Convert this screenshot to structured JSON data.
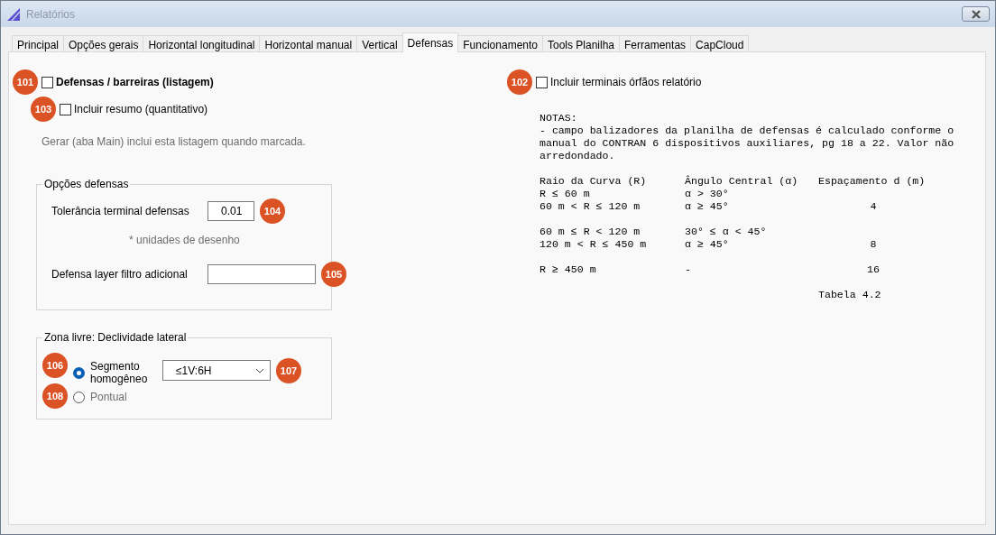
{
  "window": {
    "title": "Relatórios"
  },
  "tabs": [
    {
      "label": "Principal",
      "selected": false
    },
    {
      "label": "Opções gerais",
      "selected": false
    },
    {
      "label": "Horizontal longitudinal",
      "selected": false
    },
    {
      "label": "Horizontal manual",
      "selected": false
    },
    {
      "label": "Vertical",
      "selected": false
    },
    {
      "label": "Defensas",
      "selected": true
    },
    {
      "label": "Funcionamento",
      "selected": false
    },
    {
      "label": "Tools Planilha",
      "selected": false
    },
    {
      "label": "Ferramentas",
      "selected": false
    },
    {
      "label": "CapCloud",
      "selected": false
    }
  ],
  "listing_checkbox": {
    "label": "Defensas / barreiras (listagem)",
    "checked": false,
    "badge": "101"
  },
  "summary_checkbox": {
    "label": "Incluir resumo (quantitativo)",
    "checked": false,
    "badge": "103"
  },
  "hint": "Gerar (aba Main) inclui esta listagem quando marcada.",
  "options_group": {
    "title": "Opções defensas",
    "tolerance_field": {
      "label": "Tolerância terminal defensas",
      "value": "0.01",
      "badge": "104"
    },
    "units_note": "* unidades de desenho",
    "layer_field": {
      "label": "Defensa layer filtro adicional",
      "badge": "105"
    }
  },
  "slope_group": {
    "title": "Zona livre: Declividade lateral",
    "radios": [
      {
        "label": "Segmento homogêneo",
        "selected": true,
        "disabled": false,
        "badge": "106"
      },
      {
        "label": "Pontual",
        "selected": false,
        "disabled": true,
        "badge": "108"
      }
    ],
    "dropdown": {
      "value": "≤1V:6H",
      "badge": "107"
    }
  },
  "orphans_checkbox": {
    "label": "Incluir terminais órfãos relatório",
    "checked": false,
    "badge": "102"
  },
  "notes": {
    "title": "NOTAS:",
    "paragraph": "- campo balizadores da planilha de defensas é calculado conforme o manual do CONTRAN 6 dispositivos auxiliares, pg 18 a 22. Valor não arredondado.",
    "columns": [
      "Raio da Curva (R)",
      "Ângulo Central (α)",
      "Espaçamento d (m)"
    ],
    "groups": [
      [
        {
          "radius": "R ≤ 60 m",
          "angle": "α > 30°"
        },
        {
          "radius": "60 m < R ≤ 120 m",
          "angle": "α ≥ 45°",
          "spacing": "4"
        }
      ],
      [
        {
          "radius": "60 m ≤ R < 120 m",
          "angle": "30° ≤ α < 45°"
        },
        {
          "radius": "120 m < R ≤ 450 m",
          "angle": "α ≥ 45°",
          "spacing": "8"
        }
      ],
      [
        {
          "radius": "R ≥ 450 m",
          "angle": "-",
          "spacing": "16"
        }
      ]
    ],
    "caption": "Tabela 4.2"
  }
}
